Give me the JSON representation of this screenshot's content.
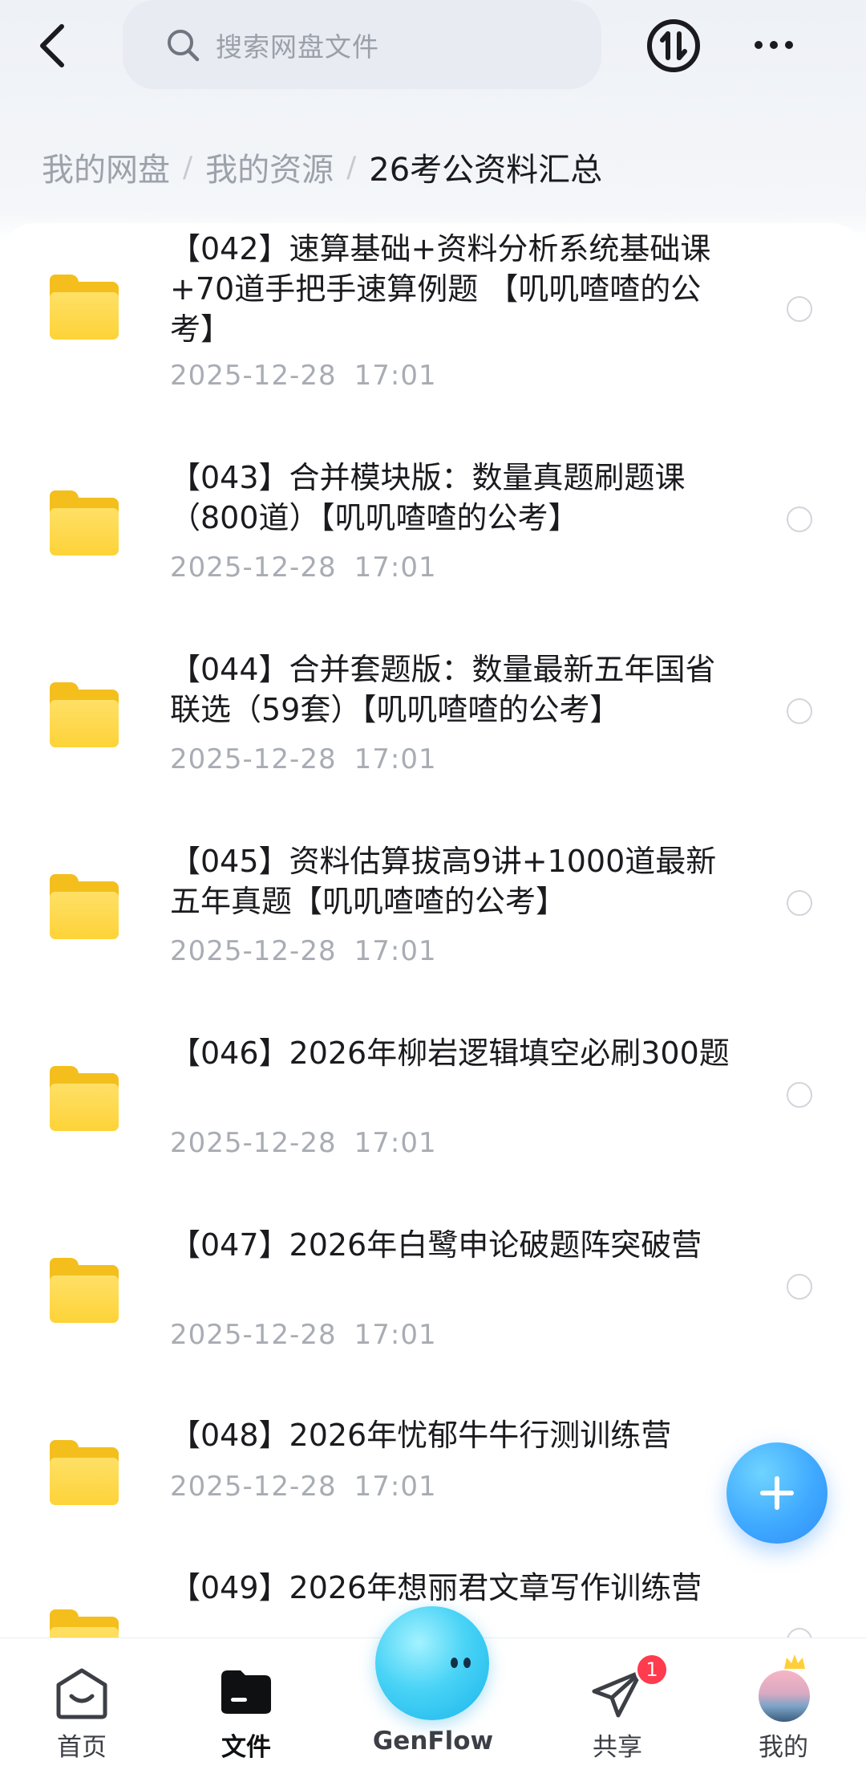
{
  "header": {
    "search_placeholder": "搜索网盘文件"
  },
  "breadcrumb": {
    "items": [
      "我的网盘",
      "我的资源",
      "26考公资料汇总"
    ],
    "separator": "/"
  },
  "files": [
    {
      "title": "【042】速算基础+资料分析系统基础课+70道手把手速算例题 【叽叽喳喳的公考】",
      "date": "2025-12-28",
      "time": "17:01"
    },
    {
      "title": "【043】合并模块版：数量真题刷题课（800道）【叽叽喳喳的公考】",
      "date": "2025-12-28",
      "time": "17:01"
    },
    {
      "title": "【044】合并套题版：数量最新五年国省联选（59套）【叽叽喳喳的公考】",
      "date": "2025-12-28",
      "time": "17:01"
    },
    {
      "title": "【045】资料估算拔高9讲+1000道最新五年真题【叽叽喳喳的公考】",
      "date": "2025-12-28",
      "time": "17:01"
    },
    {
      "title": "【046】2026年柳岩逻辑填空必刷300题",
      "date": "2025-12-28",
      "time": "17:01"
    },
    {
      "title": "【047】2026年白鹭申论破题阵突破营",
      "date": "2025-12-28",
      "time": "17:01"
    },
    {
      "title": "【048】2026年忧郁牛牛行测训练营",
      "date": "2025-12-28",
      "time": "17:01"
    },
    {
      "title": "【049】2026年想丽君文章写作训练营",
      "date": "",
      "time": ""
    }
  ],
  "bottom_nav": {
    "home": "首页",
    "files": "文件",
    "genflow": "GenFlow",
    "share": "共享",
    "share_badge": "1",
    "mine": "我的"
  },
  "colors": {
    "accent": "#3fa9ff",
    "folder": "#fdd338",
    "badge": "#ff3b4e"
  }
}
